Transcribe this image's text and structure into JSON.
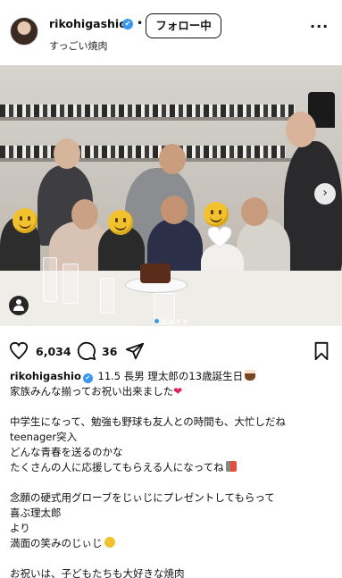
{
  "header": {
    "username": "rikohigashio",
    "verified_glyph": "✔",
    "separator": "•",
    "follow_label": "フォロー中",
    "subtitle": "すっごい焼肉",
    "more_glyph": "···"
  },
  "photo": {
    "icons": [
      "user-tag-icon",
      "next-arrow-icon"
    ],
    "next_glyph": "›",
    "carousel_count": 5,
    "carousel_active": 0
  },
  "actions": {
    "likes": "6,034",
    "comments": "36",
    "icons": [
      "heart-icon",
      "comment-icon",
      "share-icon",
      "bookmark-icon"
    ]
  },
  "caption": {
    "username": "rikohigashio",
    "lines": [
      "11.5 長男 理太郎の13歳誕生日",
      "家族みんな揃ってお祝い出来ました",
      "",
      "中学生になって、勉強も野球も友人との時間も、大忙しだね",
      "teenager突入",
      "どんな青春を送るのかな",
      "たくさんの人に応援してもらえる人になってね",
      "",
      "念願の硬式用グローブをじぃじにプレゼントしてもらって",
      "喜ぶ理太郎",
      "より",
      "満面の笑みのじぃじ",
      "",
      "お祝いは、子どもたちも大好きな焼肉"
    ]
  },
  "colors": {
    "accent": "#3897f0",
    "heart": "#e0245e",
    "text": "#111111"
  }
}
